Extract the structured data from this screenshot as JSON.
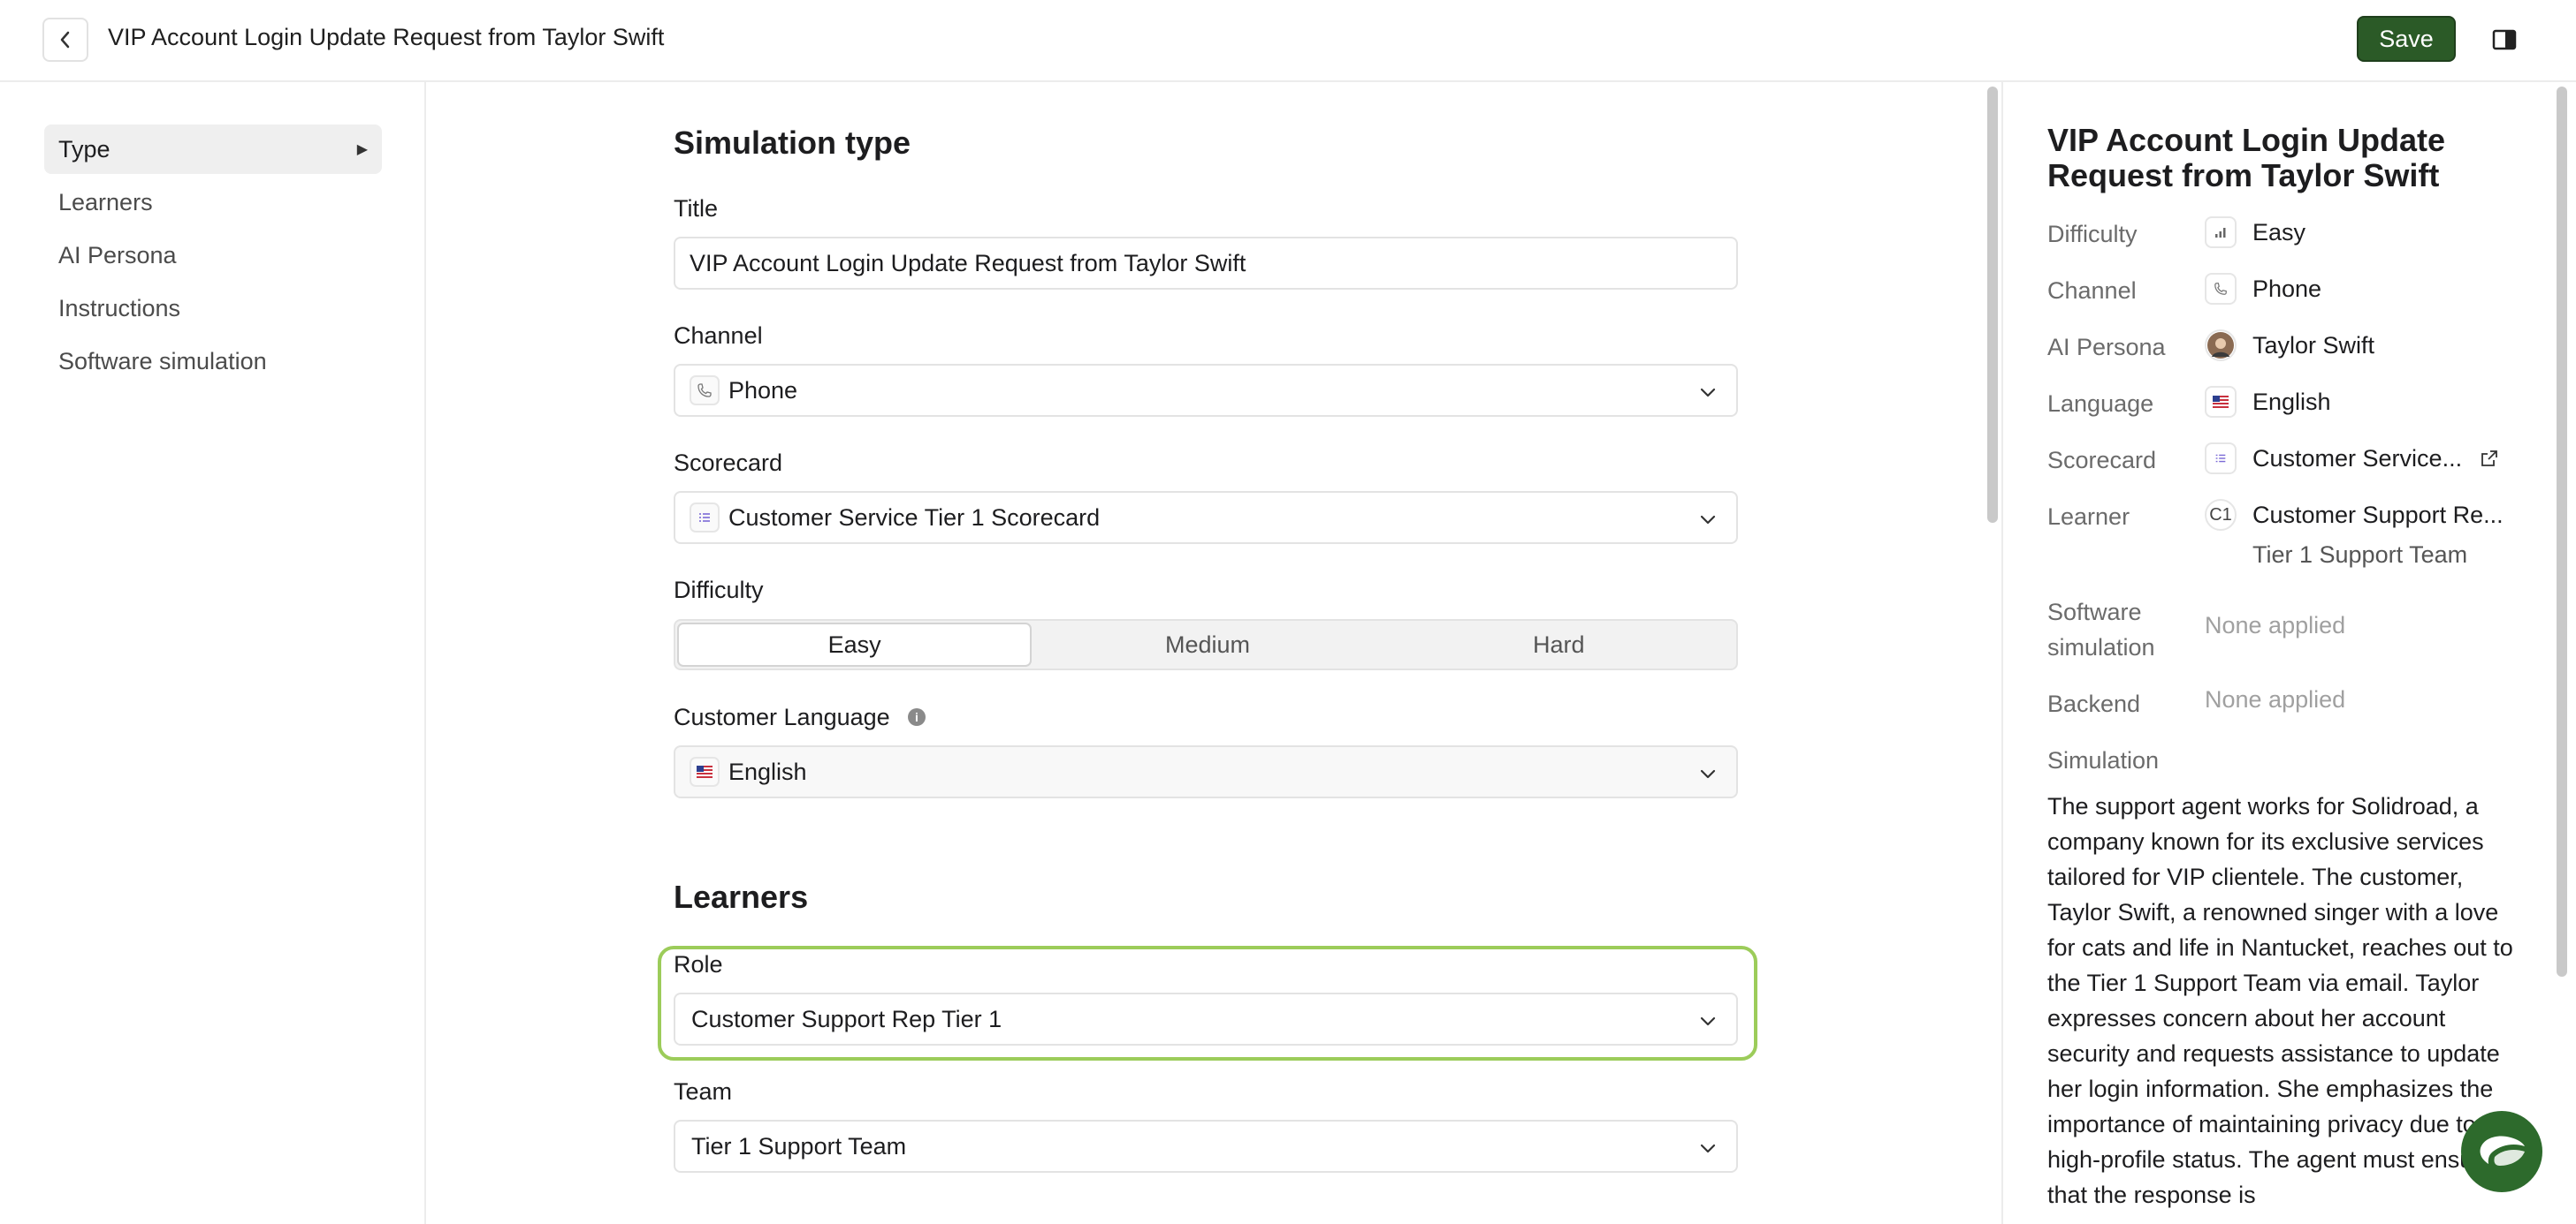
{
  "header": {
    "title": "VIP Account Login Update Request from Taylor Swift",
    "save_label": "Save"
  },
  "nav": {
    "items": [
      {
        "label": "Type"
      },
      {
        "label": "Learners"
      },
      {
        "label": "AI Persona"
      },
      {
        "label": "Instructions"
      },
      {
        "label": "Software simulation"
      }
    ]
  },
  "main": {
    "simulation_type": {
      "heading": "Simulation type",
      "title_label": "Title",
      "title_value": "VIP Account Login Update Request from Taylor Swift",
      "channel_label": "Channel",
      "channel_value": "Phone",
      "scorecard_label": "Scorecard",
      "scorecard_value": "Customer Service Tier 1 Scorecard",
      "difficulty_label": "Difficulty",
      "difficulty_options": [
        "Easy",
        "Medium",
        "Hard"
      ],
      "difficulty_selected": "Easy",
      "language_label": "Customer Language",
      "language_value": "English"
    },
    "learners": {
      "heading": "Learners",
      "role_label": "Role",
      "role_value": "Customer Support Rep Tier 1",
      "team_label": "Team",
      "team_value": "Tier 1 Support Team"
    }
  },
  "summary": {
    "title": "VIP Account Login Update Request from Taylor Swift",
    "rows": {
      "difficulty": {
        "key": "Difficulty",
        "value": "Easy"
      },
      "channel": {
        "key": "Channel",
        "value": "Phone"
      },
      "persona": {
        "key": "AI Persona",
        "value": "Taylor Swift"
      },
      "language": {
        "key": "Language",
        "value": "English"
      },
      "scorecard": {
        "key": "Scorecard",
        "value": "Customer Service..."
      },
      "learner": {
        "key": "Learner",
        "value": "Customer Support Re...",
        "sub": "Tier 1 Support Team",
        "icon_text": "C1"
      },
      "software": {
        "key_line1": "Software",
        "key_line2": "simulation",
        "value": "None applied"
      },
      "backend": {
        "key": "Backend",
        "value": "None applied"
      },
      "simulation": {
        "key": "Simulation"
      }
    },
    "simulation_text": "The support agent works for Solidroad, a company known for its exclusive services tailored for VIP clientele. The customer, Taylor Swift, a renowned singer with a love for cats and life in Nantucket, reaches out to the Tier 1 Support Team via email. Taylor expresses concern about her account security and requests assistance to update her login information. She emphasizes the importance of maintaining privacy due to her high-profile status. The agent must ensure that the response is"
  },
  "icons": {
    "back": "chevron-left-icon",
    "panel": "sidebar-toggle-icon",
    "phone": "phone-icon",
    "scorecard": "list-icon",
    "flag": "us-flag-icon",
    "difficulty": "signal-bars-icon",
    "external": "external-link-icon",
    "chat": "chat-bubble-icon"
  },
  "colors": {
    "save_bg": "#2b5a27",
    "highlight": "#9ccc5a",
    "fab_bg": "#2d6a2c"
  }
}
